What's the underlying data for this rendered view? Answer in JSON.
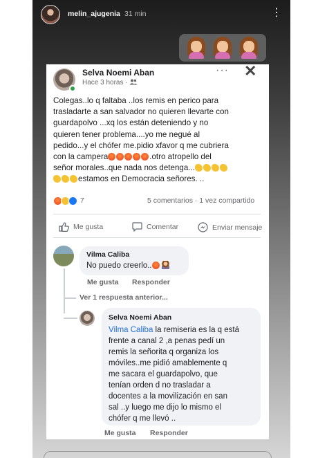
{
  "story": {
    "username": "melin_ajugenia",
    "time": "31 min",
    "menu_icon": "⋮",
    "sticker_icons": [
      "woman-emoji",
      "woman-emoji",
      "woman-emoji"
    ]
  },
  "post": {
    "author": "Selva Noemi Aban",
    "meta": "Hace 3 horas ·",
    "more_icon": "···",
    "close_icon": "✕",
    "text_lines": [
      "Colegas..lo q faltaba ..los remis en perico para",
      "trasladarte a san salvador no quieren llevarte con",
      "guardapolvo ...xq los están deteniendo y no",
      "quieren tener problema....yo me negué al",
      "pedido...y el chófer me.pidio xfavor q me cubriera",
      "con la campera",
      ".otro atropello del",
      "señor morales..que nada nos detenga...",
      "estamos en Democracia señores. .."
    ],
    "reaction_count": "7",
    "stats": "5 comentarios · 1 vez compartido",
    "actions": {
      "like": "Me gusta",
      "comment": "Comentar",
      "share": "Enviar mensaje"
    }
  },
  "comments": [
    {
      "author": "Vilma Caliba",
      "text": "No puedo creerlo..",
      "like": "Me gusta",
      "reply": "Responder"
    }
  ],
  "previous_replies": "Ver 1 respuesta anterior...",
  "reply": {
    "author": "Selva Noemi Aban",
    "mention": "Vilma Caliba",
    "lines": [
      " la remiseria es la q está",
      "frente a canal 2 ,a penas pedí un",
      "remis la señorita q organiza los",
      "móviles..me pidió amablemente q",
      "me sacara el guardapolvo, que",
      "tenían orden d no trasladar a",
      "docentes  a la movilización en san",
      "sal ..y luego me dijo lo mismo el",
      "chófer q me llevó .."
    ],
    "like": "Me gusta",
    "reply": "Responder"
  },
  "colors": {
    "facebook_blue": "#216fdb",
    "online_green": "#31a24c",
    "meta_gray": "#65676b"
  }
}
